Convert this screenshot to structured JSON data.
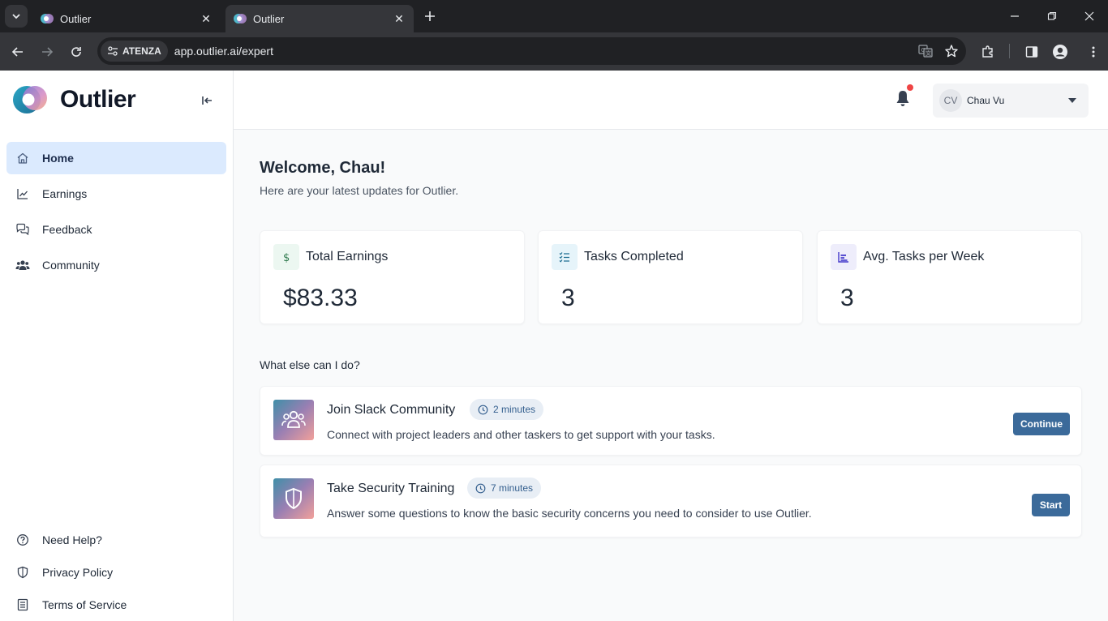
{
  "browser": {
    "tabs": [
      {
        "title": "Outlier",
        "active": false
      },
      {
        "title": "Outlier",
        "active": true
      }
    ],
    "site_chip": "ATENZA",
    "url": "app.outlier.ai/expert"
  },
  "app": {
    "brand": "Outlier",
    "accent": "#3b6a9a",
    "nav": [
      {
        "label": "Home",
        "icon": "home-icon",
        "active": true
      },
      {
        "label": "Earnings",
        "icon": "chart-line-icon",
        "active": false
      },
      {
        "label": "Feedback",
        "icon": "chat-bubbles-icon",
        "active": false
      },
      {
        "label": "Community",
        "icon": "users-icon",
        "active": false
      }
    ],
    "footer_nav": [
      {
        "label": "Need Help?",
        "icon": "help-circle-icon"
      },
      {
        "label": "Privacy Policy",
        "icon": "shield-icon"
      },
      {
        "label": "Terms of Service",
        "icon": "document-list-icon"
      }
    ]
  },
  "header": {
    "user_initials": "CV",
    "user_name": "Chau Vu",
    "has_notification": true
  },
  "main": {
    "welcome_title": "Welcome, Chau!",
    "welcome_subtitle": "Here are your latest updates for Outlier.",
    "stats": [
      {
        "title": "Total Earnings",
        "value": "$83.33",
        "icon": "dollar-icon"
      },
      {
        "title": "Tasks Completed",
        "value": "3",
        "icon": "checklist-icon"
      },
      {
        "title": "Avg. Tasks per Week",
        "value": "3",
        "icon": "bar-chart-icon"
      }
    ],
    "section_title": "What else can I do?",
    "tasks": [
      {
        "title": "Join Slack Community",
        "duration": "2 minutes",
        "description": "Connect with project leaders and other taskers to get support with your tasks.",
        "button": "Continue",
        "icon": "users-icon"
      },
      {
        "title": "Take Security Training",
        "duration": "7 minutes",
        "description": "Answer some questions to know the basic security concerns you need to consider to use Outlier.",
        "button": "Start",
        "icon": "shield-icon"
      }
    ]
  }
}
